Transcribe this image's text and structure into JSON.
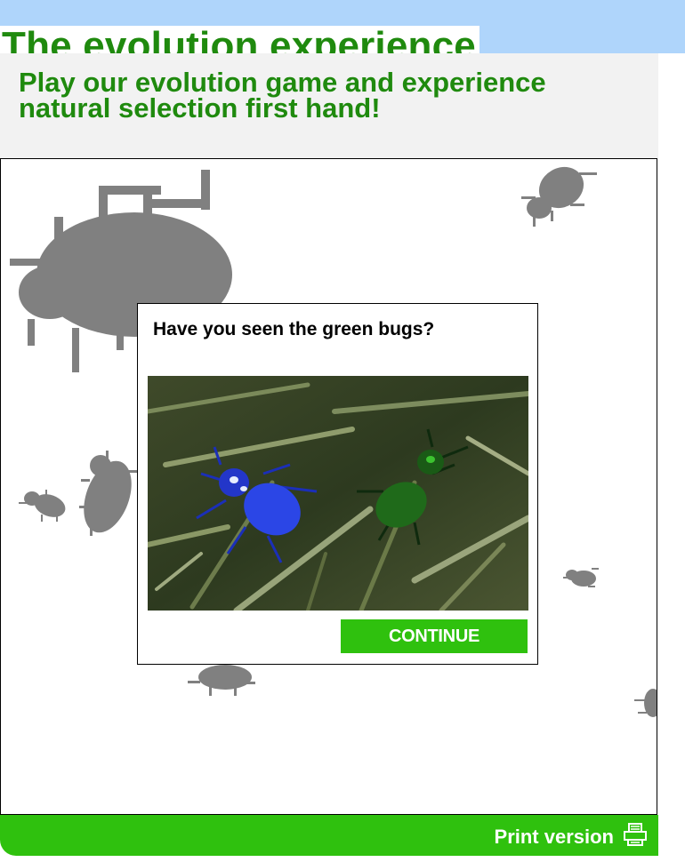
{
  "header": {
    "title": "The evolution experience"
  },
  "intro": {
    "text": "Play our evolution game and experience natural selection first hand!"
  },
  "game": {
    "background_bugs": [
      {
        "name": "large-grey-bug",
        "color": "#808080"
      },
      {
        "name": "grey-bug",
        "color": "#808080"
      }
    ]
  },
  "dialog": {
    "title": "Have you seen the green bugs?",
    "image": {
      "subject": "blue-bug and green-bug on grass",
      "blue_bug_color": "#2b46e6",
      "green_bug_color": "#1f6a1a"
    },
    "continue_label": "CONTINUE"
  },
  "footer": {
    "print_label": "Print version",
    "print_icon": "printer-icon"
  },
  "colors": {
    "title_green": "#1f8a0e",
    "accent_green": "#2fc10e",
    "header_blue": "#afd5fb",
    "panel_grey": "#f2f2f2"
  }
}
